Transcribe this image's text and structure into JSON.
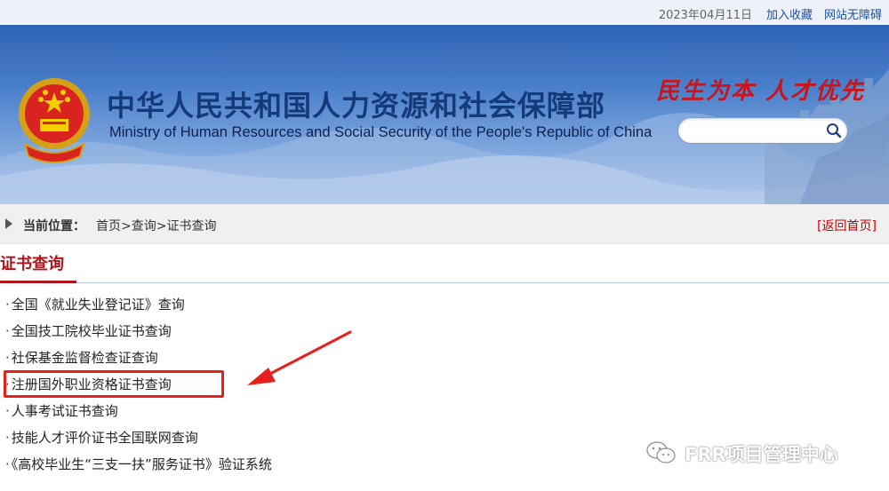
{
  "topbar": {
    "date": "2023年04月11日",
    "favorite": "加入收藏",
    "accessibility": "网站无障碍"
  },
  "header": {
    "title_cn": "中华人民共和国人力资源和社会保障部",
    "title_en": "Ministry of Human Resources and Social Security of the People's Republic of China",
    "slogan": "民生为本 人才优先",
    "search_placeholder": ""
  },
  "breadcrumb": {
    "label": "当前位置：",
    "path": "首页>查询>证书查询",
    "back": "[返回首页]"
  },
  "section": {
    "title": "证书查询"
  },
  "list": {
    "bullet": "·",
    "items": [
      "全国《就业失业登记证》查询",
      "全国技工院校毕业证书查询",
      "社保基金监督检查证查询",
      "注册国外职业资格证书查询",
      "人事考试证书查询",
      "技能人才评价证书全国联网查询",
      "《高校毕业生“三支一扶”服务证书》验证系统"
    ]
  },
  "watermark": {
    "text": "FRR项目管理中心"
  },
  "colors": {
    "accent_red": "#b0141b",
    "highlight_red": "#e8201c",
    "header_blue": "#2f63b4",
    "title_blue": "#153a7a"
  }
}
